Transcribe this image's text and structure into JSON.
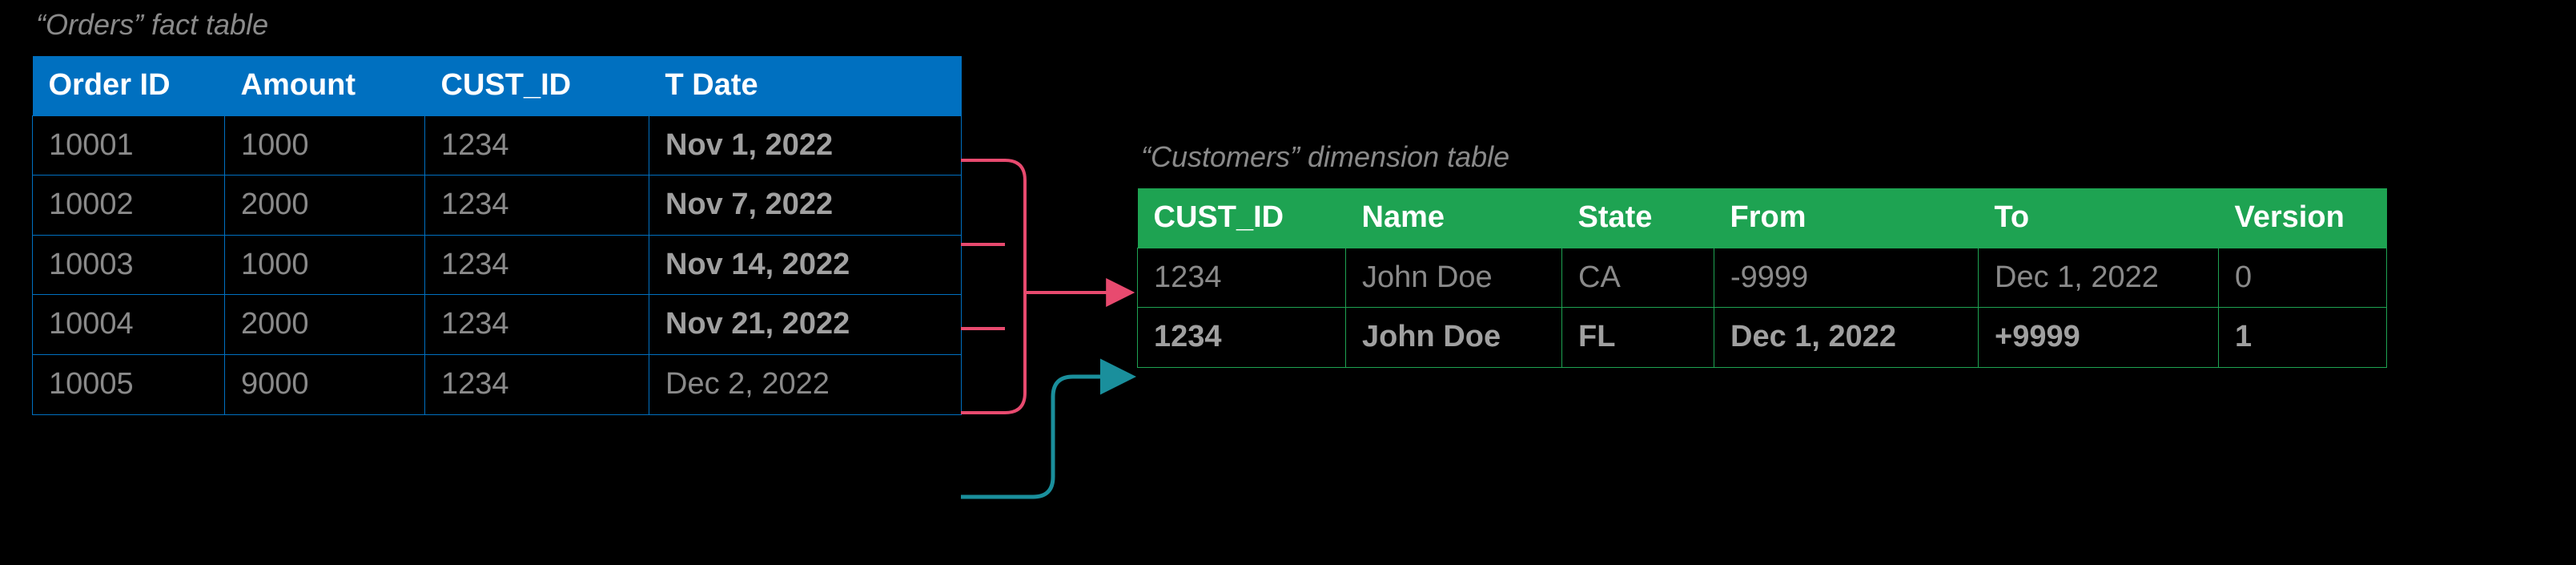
{
  "orders": {
    "caption": "“Orders” fact table",
    "headers": [
      "Order ID",
      "Amount",
      "CUST_ID",
      "T Date"
    ],
    "rows": [
      {
        "id": "10001",
        "amount": "1000",
        "cust": "1234",
        "date": "Nov 1, 2022",
        "bold_date": true
      },
      {
        "id": "10002",
        "amount": "2000",
        "cust": "1234",
        "date": "Nov 7, 2022",
        "bold_date": true
      },
      {
        "id": "10003",
        "amount": "1000",
        "cust": "1234",
        "date": "Nov 14, 2022",
        "bold_date": true
      },
      {
        "id": "10004",
        "amount": "2000",
        "cust": "1234",
        "date": "Nov 21, 2022",
        "bold_date": true
      },
      {
        "id": "10005",
        "amount": "9000",
        "cust": "1234",
        "date": "Dec 2, 2022",
        "bold_date": false
      }
    ]
  },
  "customers": {
    "caption": "“Customers” dimension table",
    "headers": [
      "CUST_ID",
      "Name",
      "State",
      "From",
      "To",
      "Version"
    ],
    "rows": [
      {
        "cust": "1234",
        "name": "John Doe",
        "state": "CA",
        "from": "-9999",
        "to": "Dec 1, 2022",
        "ver": "0",
        "bold": false
      },
      {
        "cust": "1234",
        "name": "John Doe",
        "state": "FL",
        "from": "Dec 1, 2022",
        "to": "+9999",
        "ver": "1",
        "bold": true
      }
    ]
  },
  "colors": {
    "red": "#e84a6f",
    "teal": "#1a8f9c"
  }
}
